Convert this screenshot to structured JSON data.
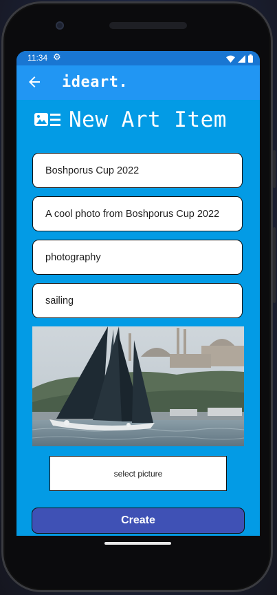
{
  "status_bar": {
    "time": "11:34",
    "settings_icon": "gear-icon",
    "icons": [
      "wifi-icon",
      "signal-icon",
      "battery-icon"
    ]
  },
  "app_bar": {
    "title": "ideart.",
    "back_icon": "arrow-back-icon"
  },
  "page": {
    "heading": "New Art Item",
    "heading_icon": "image-list-icon"
  },
  "form": {
    "title_value": "Boshporus Cup 2022",
    "description_value": "A cool photo from Boshporus Cup 2022",
    "category_value": "photography",
    "tag_value": "sailing"
  },
  "photo": {
    "subject": "sailboat-photo"
  },
  "buttons": {
    "select_picture_label": "select picture",
    "create_label": "Create"
  },
  "colors": {
    "screen_bg": "#039be5",
    "app_bar": "#2196f3",
    "status_bar": "#1976d2",
    "create_button": "#3f51b5"
  }
}
